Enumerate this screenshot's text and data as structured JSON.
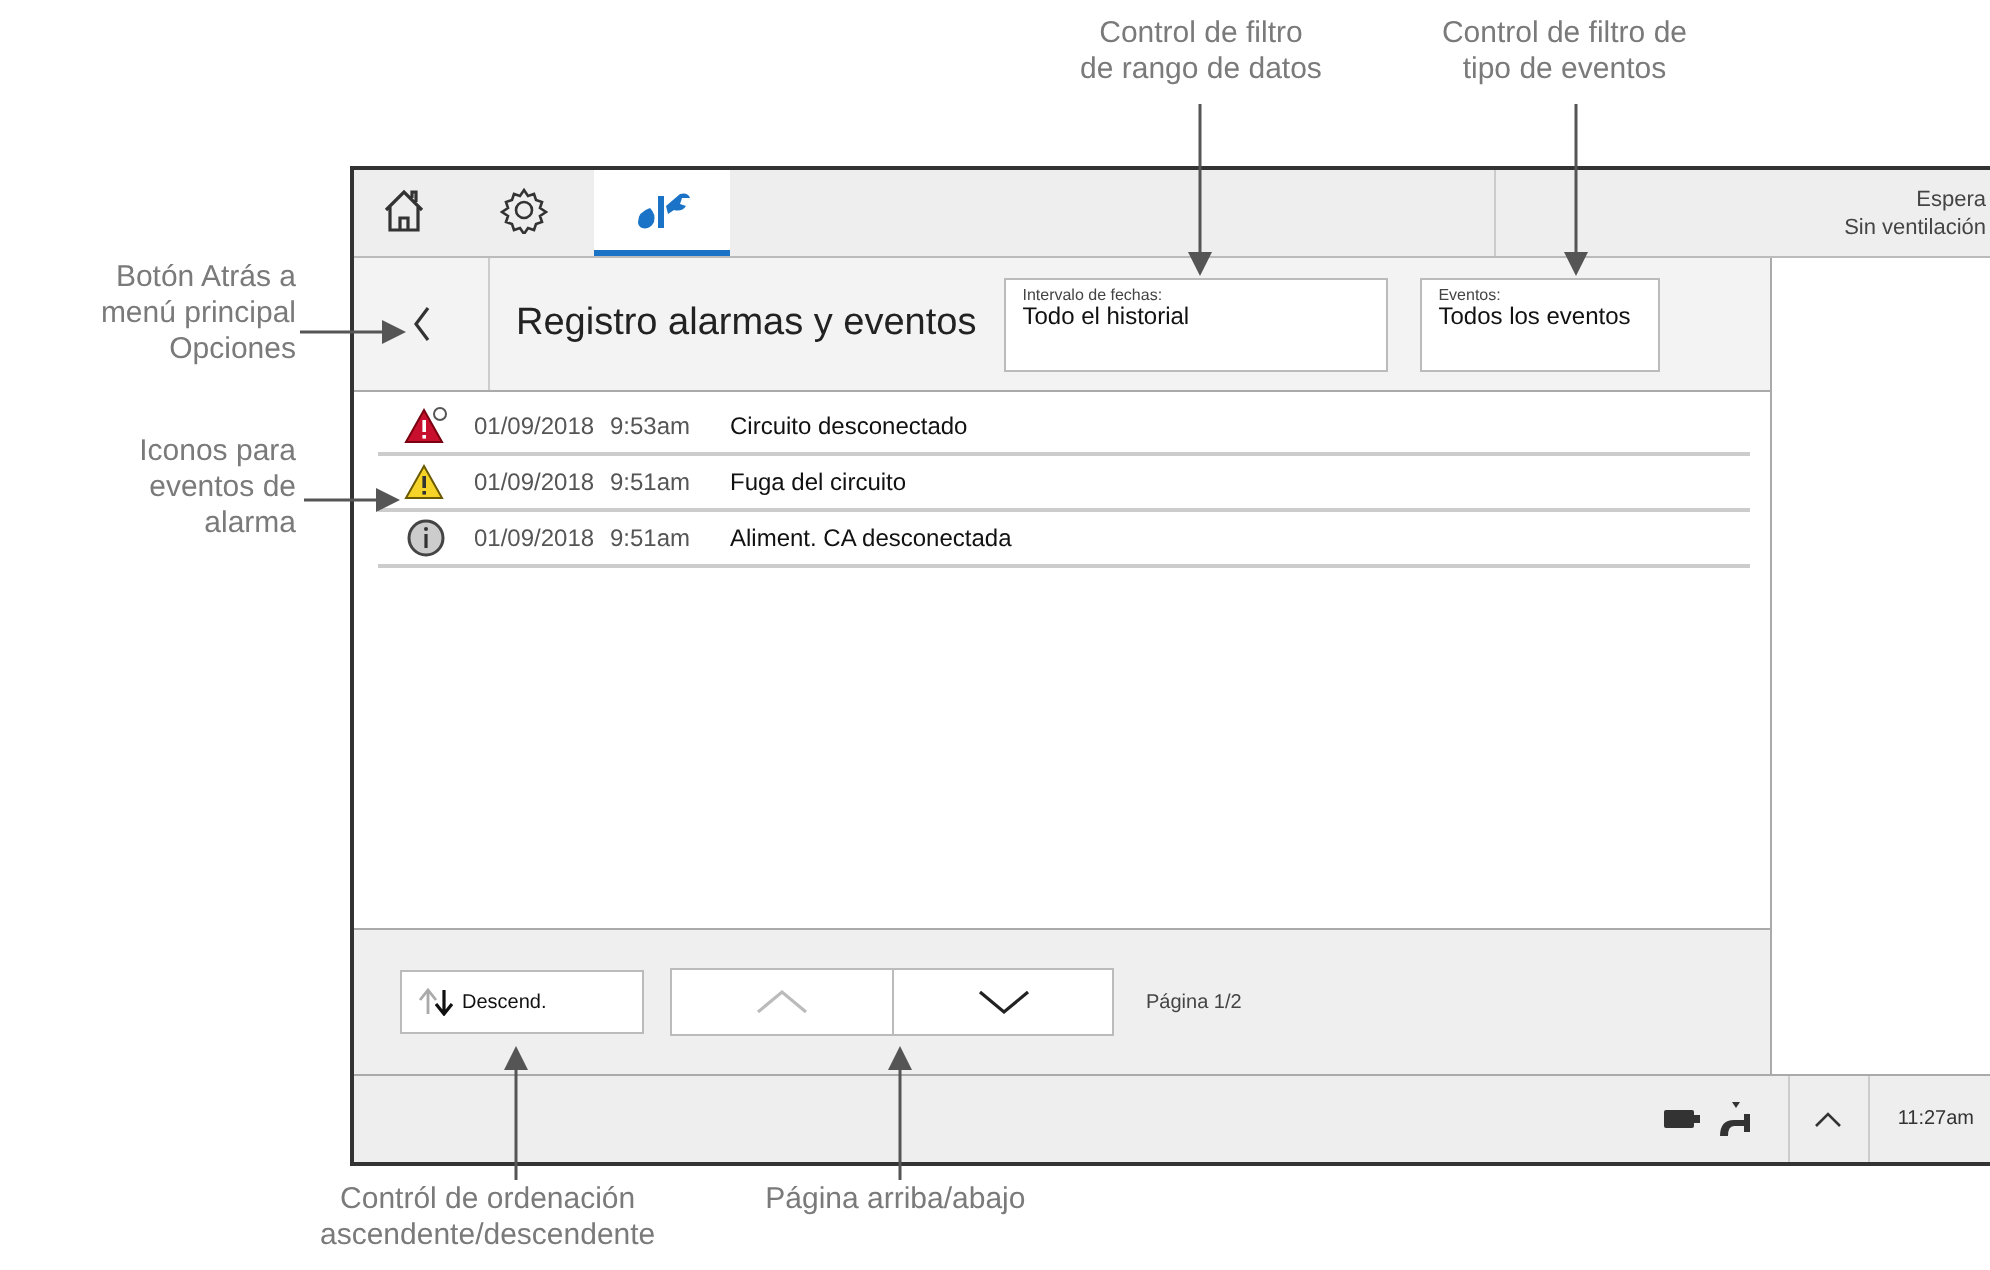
{
  "top_callouts": [
    "Control de filtro\nde rango de datos",
    "Control de filtro de\ntipo de eventos"
  ],
  "left_callouts": [
    "Botón Atrás a\nmenú principal\nOpciones",
    "Iconos para\neventos de\nalarma"
  ],
  "bottom_callouts": [
    "Contról de ordenación\nascendente/descendente",
    "Página arriba/abajo"
  ],
  "tabs": [
    {
      "kind": "home",
      "selected": false
    },
    {
      "kind": "settings",
      "selected": false
    },
    {
      "kind": "service",
      "selected": true
    }
  ],
  "status": [
    "Espera",
    "Sin ventilación"
  ],
  "header": {
    "title": "Registro alarmas y eventos",
    "filters": [
      {
        "label": "Intervalo de fechas:",
        "value": "Todo el historial"
      },
      {
        "label": "Eventos:",
        "value": "Todos los eventos"
      }
    ]
  },
  "events": [
    {
      "kind": "alarm-high",
      "date": "01/09/2018",
      "time": "9:53am",
      "text": "Circuito desconectado"
    },
    {
      "kind": "alarm-medium",
      "date": "01/09/2018",
      "time": "9:51am",
      "text": "Fuga del circuito"
    },
    {
      "kind": "info",
      "date": "01/09/2018",
      "time": "9:51am",
      "text": "Aliment. CA desconectada"
    }
  ],
  "footer": {
    "sort": "Descend.",
    "page_up": {
      "disabled": true
    },
    "page_down": {
      "disabled": false
    },
    "page": "Página 1/2"
  },
  "status_bar": {
    "time": "11:27am"
  }
}
